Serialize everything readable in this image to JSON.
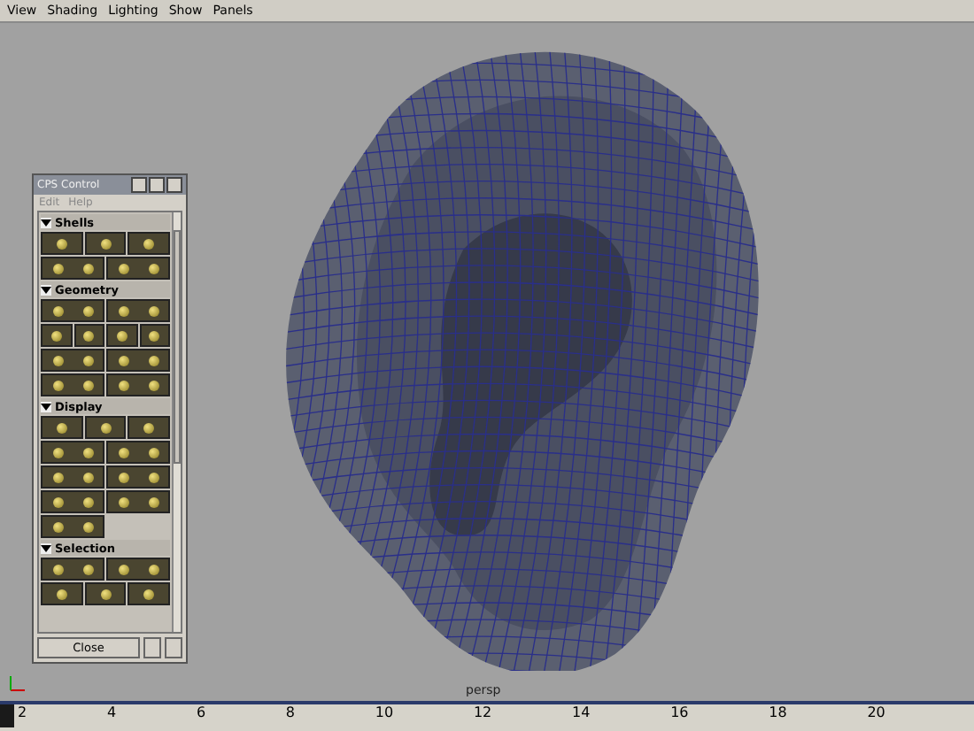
{
  "menu_bar": {
    "items": [
      "View",
      "Shading",
      "Lighting",
      "Show",
      "Panels"
    ]
  },
  "viewport": {
    "camera_label": "persp"
  },
  "cps_window": {
    "title": "CPS Control",
    "menu": [
      "Edit",
      "Help"
    ],
    "sections": [
      {
        "title": "Shells",
        "expanded": true,
        "rows": [
          [
            {
              "kind": "small"
            },
            {
              "kind": "small"
            },
            {
              "kind": "small"
            }
          ],
          [
            {
              "kind": "wide"
            },
            {
              "kind": "wide"
            }
          ]
        ]
      },
      {
        "title": "Geometry",
        "expanded": true,
        "rows": [
          [
            {
              "kind": "wide"
            },
            {
              "kind": "wide"
            }
          ],
          [
            {
              "kind": "small"
            },
            {
              "kind": "small"
            },
            {
              "kind": "small"
            },
            {
              "kind": "small"
            }
          ],
          [
            {
              "kind": "wide"
            },
            {
              "kind": "wide"
            }
          ],
          [
            {
              "kind": "wide"
            },
            {
              "kind": "wide"
            }
          ]
        ]
      },
      {
        "title": "Display",
        "expanded": true,
        "rows": [
          [
            {
              "kind": "small"
            },
            {
              "kind": "small"
            },
            {
              "kind": "small"
            }
          ],
          [
            {
              "kind": "wide"
            },
            {
              "kind": "wide"
            }
          ],
          [
            {
              "kind": "wide"
            },
            {
              "kind": "wide"
            }
          ],
          [
            {
              "kind": "wide"
            },
            {
              "kind": "wide"
            }
          ],
          [
            {
              "kind": "wide"
            }
          ]
        ]
      },
      {
        "title": "Selection",
        "expanded": true,
        "rows": [
          [
            {
              "kind": "wide"
            },
            {
              "kind": "wide"
            }
          ],
          [
            {
              "kind": "small"
            },
            {
              "kind": "small"
            },
            {
              "kind": "small"
            }
          ]
        ]
      }
    ],
    "close_button": "Close"
  },
  "time_slider": {
    "level": 0,
    "ticks": [
      "2",
      "4",
      "6",
      "8",
      "10",
      "12",
      "14",
      "16",
      "18",
      "20"
    ]
  }
}
